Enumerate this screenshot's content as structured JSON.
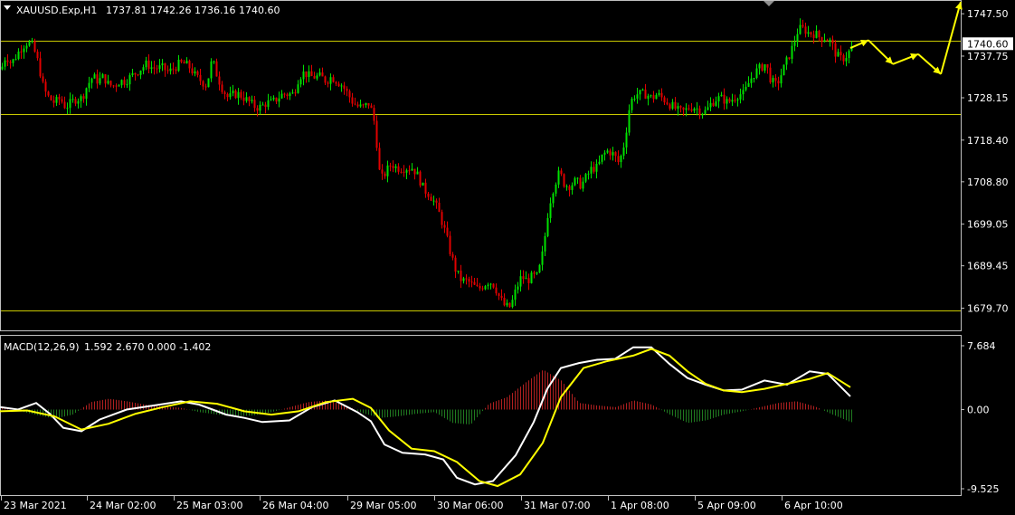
{
  "header": {
    "symbol": "XAUUSD.Exp,H1",
    "ohlc": "1737.81 1742.26 1736.16 1740.60"
  },
  "macd_header": {
    "label": "MACD(12,26,9)",
    "values": "1.592 2.670 0.000 -1.402"
  },
  "colors": {
    "background": "#000000",
    "bull": "#00e000",
    "bear": "#e00000",
    "level_line": "#c8c800",
    "forecast": "#ffff00",
    "macd_line": "#ffffff",
    "signal_line": "#ffff00",
    "hist_pos": "#b02020",
    "hist_neg": "#207a20",
    "frame": "#c0c0c0"
  },
  "chart_data": [
    {
      "type": "candlestick",
      "symbol": "XAUUSD.Exp,H1",
      "ylim": [
        1677.5,
        1749.0
      ],
      "price_ticks": [
        "1747.50",
        "1737.75",
        "1728.15",
        "1718.40",
        "1708.80",
        "1699.05",
        "1689.45",
        "1679.70"
      ],
      "current_price": "1740.60",
      "horizontal_levels": [
        1741.3,
        1724.5,
        1679.1
      ],
      "time_labels": [
        "23 Mar 2021",
        "24 Mar 02:00",
        "25 Mar 03:00",
        "26 Mar 04:00",
        "29 Mar 05:00",
        "30 Mar 06:00",
        "31 Mar 07:00",
        "1 Apr 08:00",
        "5 Apr 09:00",
        "6 Apr 10:00"
      ],
      "close_path": [
        [
          0,
          1734
        ],
        [
          6,
          1738
        ],
        [
          12,
          1736
        ],
        [
          18,
          1738
        ],
        [
          24,
          1740
        ],
        [
          30,
          1741
        ],
        [
          36,
          1740
        ],
        [
          42,
          1736
        ],
        [
          48,
          1730
        ],
        [
          54,
          1728
        ],
        [
          60,
          1727
        ],
        [
          66,
          1728
        ],
        [
          72,
          1726
        ],
        [
          78,
          1727
        ],
        [
          84,
          1728
        ],
        [
          90,
          1728
        ],
        [
          96,
          1731
        ],
        [
          102,
          1733
        ],
        [
          108,
          1732
        ],
        [
          114,
          1733
        ],
        [
          120,
          1731
        ],
        [
          126,
          1731
        ],
        [
          132,
          1732
        ],
        [
          138,
          1732
        ],
        [
          144,
          1733
        ],
        [
          150,
          1734
        ],
        [
          156,
          1735
        ],
        [
          162,
          1736
        ],
        [
          168,
          1735
        ],
        [
          174,
          1735
        ],
        [
          180,
          1735
        ],
        [
          186,
          1734
        ],
        [
          192,
          1735
        ],
        [
          198,
          1736
        ],
        [
          204,
          1736
        ],
        [
          210,
          1735
        ],
        [
          216,
          1733
        ],
        [
          222,
          1732
        ],
        [
          228,
          1731
        ],
        [
          234,
          1737
        ],
        [
          240,
          1733
        ],
        [
          246,
          1730
        ],
        [
          252,
          1728
        ],
        [
          258,
          1729
        ],
        [
          264,
          1729
        ],
        [
          270,
          1728
        ],
        [
          276,
          1727
        ],
        [
          282,
          1726
        ],
        [
          288,
          1726
        ],
        [
          294,
          1727
        ],
        [
          300,
          1727
        ],
        [
          306,
          1728
        ],
        [
          312,
          1729
        ],
        [
          318,
          1729
        ],
        [
          324,
          1729
        ],
        [
          330,
          1733
        ],
        [
          336,
          1734
        ],
        [
          342,
          1733
        ],
        [
          348,
          1733
        ],
        [
          354,
          1733
        ],
        [
          360,
          1732
        ],
        [
          366,
          1733
        ],
        [
          372,
          1732
        ],
        [
          378,
          1731
        ],
        [
          384,
          1729
        ],
        [
          390,
          1727
        ],
        [
          396,
          1726
        ],
        [
          402,
          1726
        ],
        [
          408,
          1727
        ],
        [
          414,
          1722
        ],
        [
          420,
          1709
        ],
        [
          426,
          1711
        ],
        [
          432,
          1713
        ],
        [
          438,
          1712
        ],
        [
          444,
          1712
        ],
        [
          450,
          1712
        ],
        [
          456,
          1712
        ],
        [
          462,
          1710
        ],
        [
          468,
          1707
        ],
        [
          474,
          1706
        ],
        [
          480,
          1704
        ],
        [
          486,
          1701
        ],
        [
          492,
          1697
        ],
        [
          498,
          1692
        ],
        [
          504,
          1688
        ],
        [
          510,
          1686
        ],
        [
          516,
          1686
        ],
        [
          522,
          1685
        ],
        [
          528,
          1684
        ],
        [
          534,
          1685
        ],
        [
          540,
          1686
        ],
        [
          546,
          1685
        ],
        [
          552,
          1682
        ],
        [
          558,
          1680
        ],
        [
          564,
          1680
        ],
        [
          570,
          1684
        ],
        [
          576,
          1687
        ],
        [
          582,
          1686
        ],
        [
          588,
          1687
        ],
        [
          594,
          1687
        ],
        [
          600,
          1693
        ],
        [
          606,
          1703
        ],
        [
          612,
          1708
        ],
        [
          618,
          1711
        ],
        [
          624,
          1708
        ],
        [
          630,
          1708
        ],
        [
          636,
          1709
        ],
        [
          642,
          1708
        ],
        [
          648,
          1710
        ],
        [
          654,
          1712
        ],
        [
          660,
          1712
        ],
        [
          666,
          1715
        ],
        [
          672,
          1716
        ],
        [
          678,
          1715
        ],
        [
          684,
          1713
        ],
        [
          690,
          1718
        ],
        [
          696,
          1727
        ],
        [
          702,
          1729
        ],
        [
          708,
          1729
        ],
        [
          714,
          1729
        ],
        [
          720,
          1728
        ],
        [
          726,
          1729
        ],
        [
          732,
          1728
        ],
        [
          738,
          1727
        ],
        [
          744,
          1726
        ],
        [
          750,
          1725
        ],
        [
          756,
          1725
        ],
        [
          762,
          1726
        ],
        [
          768,
          1726
        ],
        [
          774,
          1725
        ],
        [
          780,
          1725
        ],
        [
          786,
          1727
        ],
        [
          792,
          1728
        ],
        [
          798,
          1728
        ],
        [
          804,
          1727
        ],
        [
          810,
          1728
        ],
        [
          816,
          1729
        ],
        [
          822,
          1729
        ],
        [
          828,
          1732
        ],
        [
          834,
          1734
        ],
        [
          840,
          1735
        ],
        [
          846,
          1736
        ],
        [
          852,
          1732
        ],
        [
          858,
          1731
        ],
        [
          864,
          1734
        ],
        [
          870,
          1737
        ],
        [
          876,
          1740
        ],
        [
          882,
          1744
        ],
        [
          888,
          1744
        ],
        [
          894,
          1743
        ],
        [
          900,
          1743
        ],
        [
          906,
          1742
        ],
        [
          912,
          1742
        ],
        [
          918,
          1741
        ],
        [
          924,
          1738
        ],
        [
          930,
          1737
        ],
        [
          936,
          1738
        ],
        [
          942,
          1740
        ]
      ],
      "forecast_path": [
        [
          1740.0,
          1740.9
        ],
        [
          1741.4,
          1741.3
        ],
        [
          1735.9
        ],
        [
          1738.2
        ],
        [
          1733.7
        ],
        [
          1749.0
        ]
      ],
      "forecast_x": [
        940,
        960,
        985,
        1015,
        1038,
        1062
      ]
    },
    {
      "type": "line",
      "name": "MACD(12,26,9)",
      "ylim": [
        -9.525,
        7.684
      ],
      "ticks": [
        "7.684",
        "0.00",
        "-9.525"
      ],
      "series": [
        {
          "name": "MACD",
          "x": [
            0,
            20,
            40,
            55,
            70,
            90,
            110,
            140,
            170,
            200,
            220,
            235,
            250,
            270,
            290,
            320,
            345,
            370,
            395,
            410,
            425,
            445,
            470,
            490,
            505,
            525,
            545,
            570,
            590,
            605,
            620,
            640,
            660,
            680,
            700,
            720,
            740,
            760,
            780,
            800,
            820,
            845,
            870,
            895,
            915,
            940
          ],
          "values": [
            0.3,
            0.0,
            0.8,
            -0.5,
            -2.2,
            -2.6,
            -1.2,
            0.0,
            0.5,
            1.0,
            0.6,
            0.0,
            -0.6,
            -1.0,
            -1.5,
            -1.3,
            0.3,
            1.1,
            -0.3,
            -1.4,
            -4.2,
            -5.2,
            -5.4,
            -6.0,
            -8.2,
            -9.0,
            -8.6,
            -5.5,
            -1.5,
            2.5,
            5.0,
            5.6,
            6.0,
            6.1,
            7.5,
            7.5,
            5.5,
            3.8,
            3.0,
            2.3,
            2.4,
            3.5,
            3.0,
            4.6,
            4.3,
            1.6
          ]
        },
        {
          "name": "Signal",
          "x": [
            0,
            30,
            60,
            90,
            120,
            150,
            180,
            210,
            240,
            270,
            300,
            330,
            360,
            390,
            410,
            430,
            455,
            480,
            505,
            530,
            550,
            575,
            600,
            620,
            645,
            670,
            700,
            720,
            740,
            760,
            780,
            800,
            820,
            845,
            870,
            895,
            915,
            940
          ],
          "values": [
            -0.2,
            -0.1,
            -0.8,
            -2.4,
            -1.7,
            -0.5,
            0.3,
            1.0,
            0.7,
            -0.2,
            -0.6,
            -0.2,
            0.9,
            1.3,
            0.2,
            -2.5,
            -4.7,
            -5.0,
            -6.3,
            -8.6,
            -9.2,
            -7.8,
            -4.0,
            1.5,
            5.0,
            5.8,
            6.5,
            7.3,
            6.5,
            4.6,
            3.1,
            2.3,
            2.1,
            2.5,
            3.1,
            3.7,
            4.4,
            2.7
          ]
        }
      ],
      "histogram": {
        "x": [
          0,
          30,
          60,
          80,
          100,
          120,
          140,
          160,
          180,
          200,
          220,
          240,
          260,
          280,
          300,
          320,
          340,
          360,
          380,
          400,
          420,
          440,
          460,
          480,
          500,
          520,
          540,
          560,
          580,
          600,
          620,
          640,
          660,
          680,
          700,
          720,
          740,
          760,
          780,
          800,
          820,
          840,
          860,
          880,
          900,
          920,
          940
        ],
        "values": [
          0.4,
          -0.4,
          -1.1,
          -0.6,
          0.9,
          1.3,
          1.0,
          0.6,
          0.4,
          0.2,
          -0.3,
          -0.6,
          -0.8,
          -0.7,
          -0.3,
          0.3,
          0.9,
          1.1,
          0.6,
          -0.4,
          -1.0,
          -0.8,
          -0.5,
          -0.3,
          -1.6,
          -1.8,
          0.7,
          1.5,
          3.2,
          4.8,
          3.5,
          0.8,
          0.5,
          0.3,
          1.1,
          0.6,
          -0.6,
          -1.6,
          -1.3,
          -0.6,
          -0.2,
          0.3,
          0.8,
          1.0,
          0.4,
          -0.6,
          -1.5
        ]
      }
    }
  ]
}
